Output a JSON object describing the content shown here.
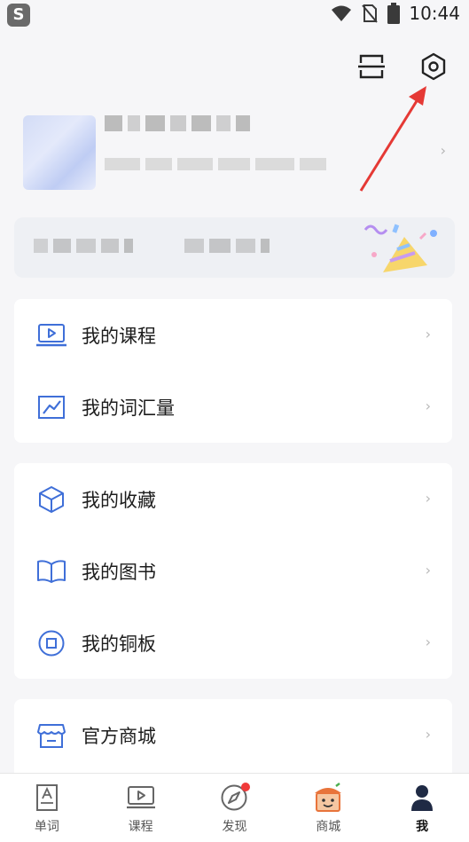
{
  "status_bar": {
    "app_glyph": "S",
    "time": "10:44"
  },
  "menu_group_1": [
    {
      "label": "我的课程",
      "icon": "laptop-play-icon"
    },
    {
      "label": "我的词汇量",
      "icon": "trend-chart-icon"
    }
  ],
  "menu_group_2": [
    {
      "label": "我的收藏",
      "icon": "cube-icon"
    },
    {
      "label": "我的图书",
      "icon": "open-book-icon"
    },
    {
      "label": "我的铜板",
      "icon": "coin-icon"
    }
  ],
  "menu_group_3": [
    {
      "label": "官方商城",
      "icon": "store-icon"
    }
  ],
  "tabs": [
    {
      "label": "单词",
      "icon": "word-card-icon"
    },
    {
      "label": "课程",
      "icon": "course-screen-icon"
    },
    {
      "label": "发现",
      "icon": "compass-icon"
    },
    {
      "label": "商城",
      "icon": "mall-icon"
    },
    {
      "label": "我",
      "icon": "user-icon"
    }
  ],
  "chevron": "›",
  "colors": {
    "accent": "#3f6fd8",
    "arrow": "#e53935",
    "badge": "#f03a3a",
    "background": "#f6f6f8"
  }
}
